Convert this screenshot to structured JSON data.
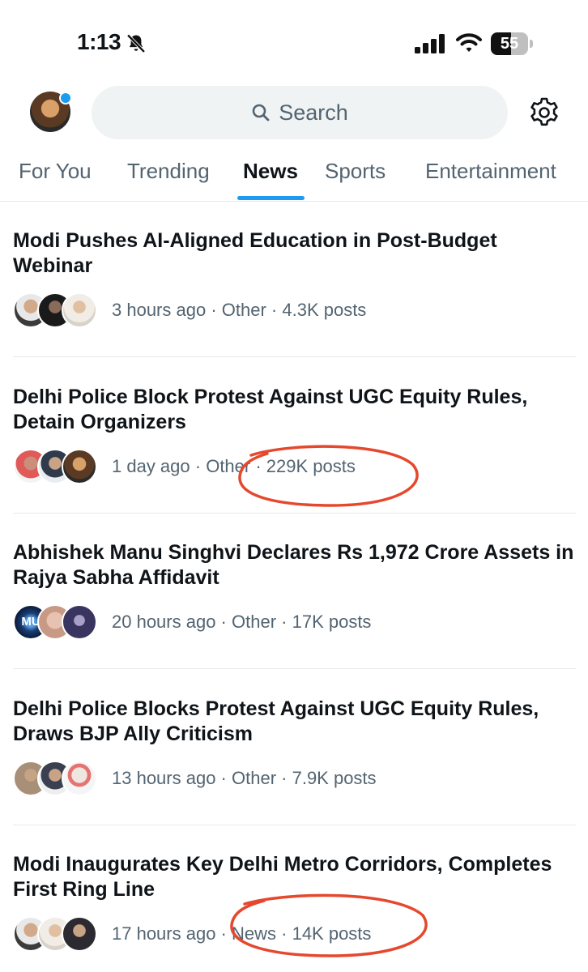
{
  "status_bar": {
    "time": "1:13",
    "battery_level": "55",
    "icons": [
      "bell-slash-icon",
      "signal-icon",
      "wifi-icon",
      "battery-icon"
    ]
  },
  "header": {
    "search_label": "Search",
    "icons": [
      "search-icon",
      "gear-icon"
    ],
    "avatar_badge_color": "#1d9bf0"
  },
  "tabs": [
    {
      "label": "For You",
      "active": false
    },
    {
      "label": "Trending",
      "active": false
    },
    {
      "label": "News",
      "active": true
    },
    {
      "label": "Sports",
      "active": false
    },
    {
      "label": "Entertainment",
      "active": false
    }
  ],
  "stories": [
    {
      "headline": "Modi Pushes AI-Aligned Education in Post-Budget Webinar",
      "time": "3 hours ago",
      "category": "Other",
      "posts": "4.3K posts",
      "highlighted": false
    },
    {
      "headline": "Delhi Police Block Protest Against UGC Equity Rules, Detain Organizers",
      "time": "1 day ago",
      "category": "Other",
      "posts": "229K posts",
      "highlighted": true
    },
    {
      "headline": "Abhishek Manu Singhvi Declares Rs 1,972 Crore Assets in Rajya Sabha Affidavit",
      "time": "20 hours ago",
      "category": "Other",
      "posts": "17K posts",
      "highlighted": false,
      "first_avatar_text": "MU"
    },
    {
      "headline": "Delhi Police Blocks Protest Against UGC Equity Rules, Draws BJP Ally Criticism",
      "time": "13 hours ago",
      "category": "Other",
      "posts": "7.9K posts",
      "highlighted": false
    },
    {
      "headline": "Modi Inaugurates Key Delhi Metro Corridors, Completes First Ring Line",
      "time": "17 hours ago",
      "category": "News",
      "posts": "14K posts",
      "highlighted": true
    }
  ],
  "colors": {
    "accent": "#1d9bf0",
    "secondary_text": "#536471",
    "annotation": "#e5482d"
  }
}
